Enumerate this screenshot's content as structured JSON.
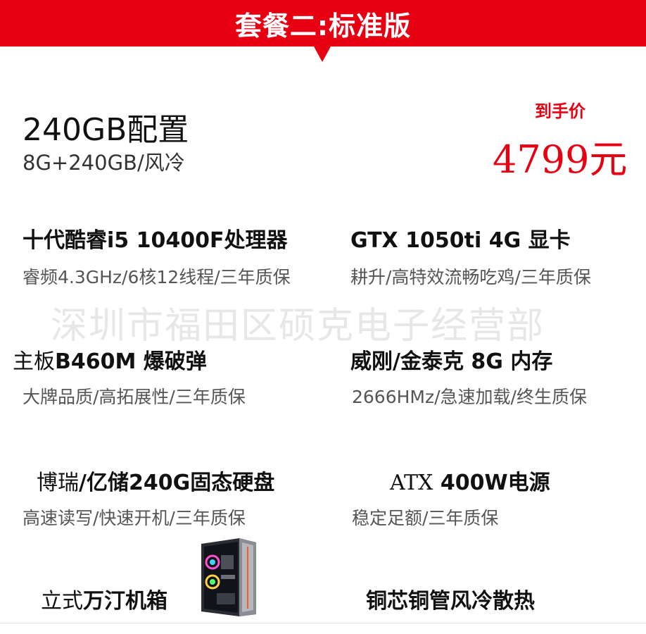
{
  "banner": {
    "title": "套餐二:标准版"
  },
  "header": {
    "title": "240GB配置",
    "subtitle": "8G+240GB/风冷",
    "price_label": "到手价",
    "price_value": "4799元"
  },
  "watermark": "深圳市福田区硕克电子经营部",
  "specs": {
    "cpu": {
      "title": "十代酷睿i5 10400F处理器",
      "desc": "睿频4.3GHz/6核12线程/三年质保"
    },
    "gpu": {
      "title": "GTX 1050ti 4G 显卡",
      "desc": "耕升/高特效流畅吃鸡/三年质保"
    },
    "board": {
      "title_serif": "主板",
      "title_bold": "B460M 爆破弹",
      "desc": "大牌品质/高拓展性/三年质保"
    },
    "ram": {
      "title": "威刚/金泰克 8G 内存",
      "desc": "2666HMz/急速加载/终生质保"
    },
    "ssd": {
      "title_serif": "博瑞",
      "title_bold": "/亿储240G固态硬盘",
      "desc": "高速读写/快速开机/三年质保"
    },
    "psu": {
      "title_serif": "ATX",
      "title_bold": "400W电源",
      "desc": "稳定足额/三年质保"
    },
    "case": {
      "title_serif": "立式",
      "title_bold": "万汀机箱"
    },
    "cooler": {
      "title": "铜芯铜管风冷散热"
    }
  },
  "colors": {
    "accent": "#e60012"
  },
  "icons": {
    "case_image": "pc-case-icon"
  }
}
